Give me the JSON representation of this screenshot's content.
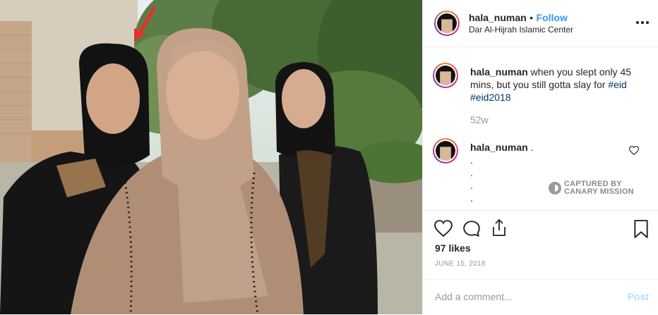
{
  "photo": {
    "description_colors": {
      "bg_wall": "#d8cfbf",
      "trees": "#4f6b3a",
      "hijab_beige": "#b9977e",
      "abaya_black": "#161616"
    }
  },
  "header": {
    "username": "hala_numan",
    "separator": "•",
    "follow_label": "Follow",
    "location": "Dar Al-Hijrah Islamic Center",
    "more_icon": "more-options-icon"
  },
  "caption": {
    "username": "hala_numan",
    "text": "when you slept only 45 mins, but you still gotta slay for",
    "hashtags": [
      "#eid",
      "#eid2018"
    ],
    "time": "52w"
  },
  "comment": {
    "username": "hala_numan",
    "text": ".",
    "dots": [
      ".",
      ".",
      ".",
      "."
    ]
  },
  "watermark": {
    "line1": "CAPTURED BY",
    "line2": "CANARY MISSION"
  },
  "actions": {
    "like_icon": "heart-icon",
    "comment_icon": "comment-icon",
    "share_icon": "share-icon",
    "save_icon": "bookmark-icon"
  },
  "likes": "97 likes",
  "date": "JUNE 15, 2018",
  "add_comment": {
    "placeholder": "Add a comment...",
    "post_label": "Post"
  },
  "colors": {
    "link_blue": "#3897f0",
    "hashtag": "#003569",
    "muted": "#999999",
    "post_disabled": "#b2dffc",
    "arrow_red": "#e8302b"
  }
}
